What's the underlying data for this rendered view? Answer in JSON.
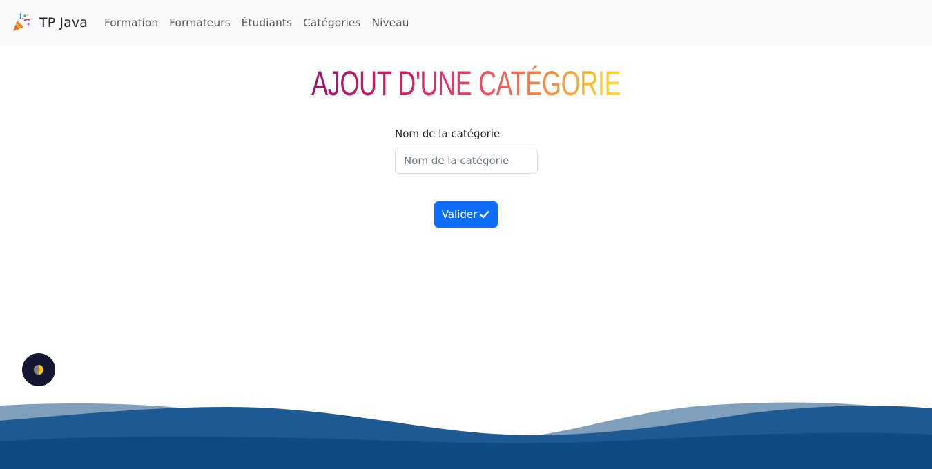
{
  "navbar": {
    "brand": "TP Java",
    "brand_icon": "party-popper-icon",
    "links": [
      "Formation",
      "Formateurs",
      "Étudiants",
      "Catégories",
      "Niveau"
    ]
  },
  "page": {
    "title": "AJOUT D'UNE CATÉGORIE"
  },
  "form": {
    "name_label": "Nom de la catégorie",
    "name_placeholder": "Nom de la catégorie",
    "name_value": "",
    "submit_label": "Valider",
    "submit_icon": "check-icon"
  },
  "theme_toggle": {
    "icon": "moon-sun-icon"
  },
  "colors": {
    "navbar_bg": "#f8f9fa",
    "primary": "#0d6efd",
    "title_gradient": [
      "#a0126e",
      "#d81b60",
      "#ee4263",
      "#f7853e",
      "#fddc22"
    ],
    "wave_light": "#7f9fbd",
    "wave_mid": "#1d5a94",
    "wave_dark": "#0e4a83",
    "toggle_bg": "#141530"
  }
}
